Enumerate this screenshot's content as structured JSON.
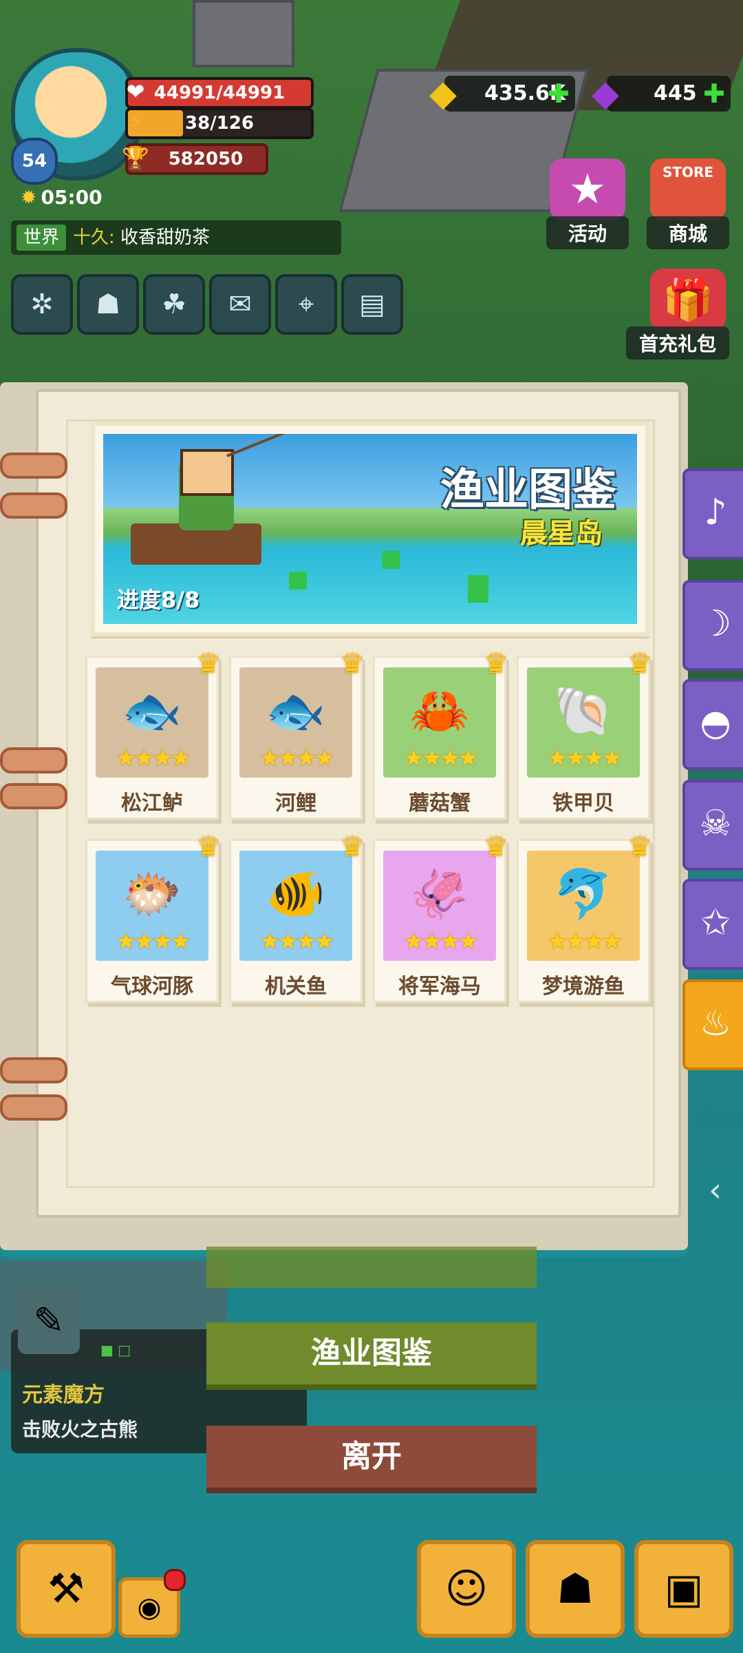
{
  "hud": {
    "level": "54",
    "hp": "44991/44991",
    "hp_fraction": 1.0,
    "stamina": "38/126",
    "stamina_fraction": 0.3,
    "power": "582050",
    "time": "05:00",
    "chat": {
      "channel": "世界",
      "sender": "十久:",
      "message": " 收香甜奶茶"
    },
    "gold": "435.6K",
    "gems": "445"
  },
  "shortcuts": {
    "event": "活动",
    "shop": "商城",
    "shop_sign": "STORE",
    "first_charge": "首充礼包"
  },
  "book": {
    "banner_title": "渔业图鉴",
    "banner_subtitle": "晨星岛",
    "progress": "进度8/8",
    "fish": [
      {
        "name": "松江鲈",
        "color": "#d6bf9f",
        "icon": "fish-icon",
        "stars": 4
      },
      {
        "name": "河鲤",
        "color": "#d6bf9f",
        "icon": "fish-icon",
        "stars": 4
      },
      {
        "name": "蘑菇蟹",
        "color": "#9ad178",
        "icon": "crab-icon",
        "stars": 4
      },
      {
        "name": "铁甲贝",
        "color": "#9ad178",
        "icon": "shell-icon",
        "stars": 4
      },
      {
        "name": "气球河豚",
        "color": "#8fcdf0",
        "icon": "pufferfish-icon",
        "stars": 4
      },
      {
        "name": "机关鱼",
        "color": "#8fcdf0",
        "icon": "mech-fish-icon",
        "stars": 4
      },
      {
        "name": "将军海马",
        "color": "#e8a6ef",
        "icon": "seahorse-icon",
        "stars": 4
      },
      {
        "name": "梦境游鱼",
        "color": "#f4c86a",
        "icon": "dream-fish-icon",
        "stars": 4
      }
    ]
  },
  "quest": {
    "title": "元素魔方",
    "desc": "击败火之古熊"
  },
  "buttons": {
    "fish_guide": "渔业图鉴",
    "leave": "离开"
  }
}
